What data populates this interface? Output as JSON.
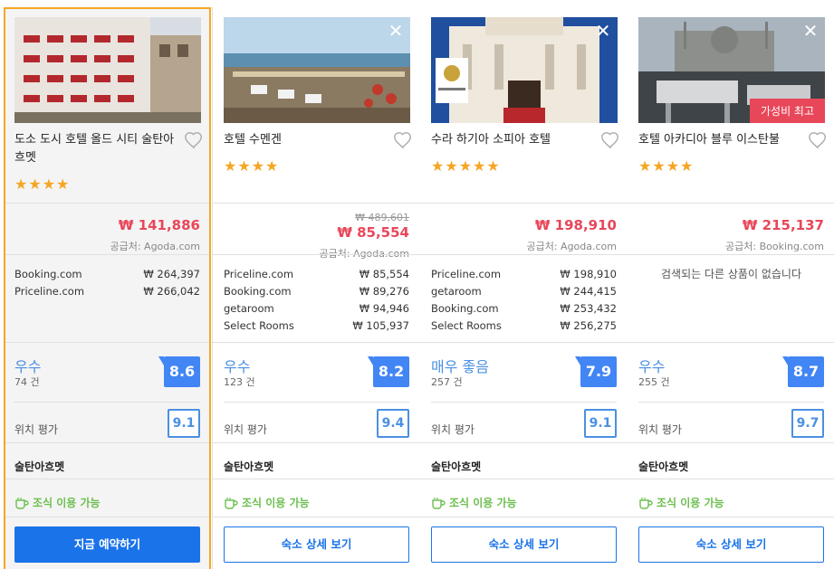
{
  "hotels": [
    {
      "name": "도소 도시 호텔 올드 시티 술탄아흐멧",
      "stars": "★★★★",
      "star_count": 4,
      "price_strike": "",
      "price": "₩ 141,886",
      "supplier": "공급처: Agoda.com",
      "offers": [
        {
          "site": "Booking.com",
          "amount": "₩  264,397"
        },
        {
          "site": "Priceline.com",
          "amount": "₩  266,042"
        }
      ],
      "no_offer_text": "",
      "rating_word": "우수",
      "review_count": "74 건",
      "score": "8.6",
      "location_label": "위치 평가",
      "location_score": "9.1",
      "area": "술탄아흐멧",
      "breakfast": "조식 이용 가능",
      "button": "지금 예약하기",
      "badge": "",
      "selected": true
    },
    {
      "name": "호텔 수멘겐",
      "stars": "★★★★",
      "star_count": 4,
      "price_strike": "₩ 489,601",
      "price": "₩ 85,554",
      "supplier": "공급처: Agoda.com",
      "offers": [
        {
          "site": "Priceline.com",
          "amount": "₩   85,554"
        },
        {
          "site": "Booking.com",
          "amount": "₩   89,276"
        },
        {
          "site": "getaroom",
          "amount": "₩   94,946"
        },
        {
          "site": "Select Rooms",
          "amount": "₩  105,937"
        }
      ],
      "no_offer_text": "",
      "rating_word": "우수",
      "review_count": "123 건",
      "score": "8.2",
      "location_label": "위치 평가",
      "location_score": "9.4",
      "area": "술탄아흐멧",
      "breakfast": "조식 이용 가능",
      "button": "숙소 상세 보기",
      "badge": "",
      "selected": false
    },
    {
      "name": "수라 하기아 소피아 호텔",
      "stars": "★★★★★",
      "star_count": 5,
      "price_strike": "",
      "price": "₩ 198,910",
      "supplier": "공급처: Agoda.com",
      "offers": [
        {
          "site": "Priceline.com",
          "amount": "₩  198,910"
        },
        {
          "site": "getaroom",
          "amount": "₩  244,415"
        },
        {
          "site": "Booking.com",
          "amount": "₩  253,432"
        },
        {
          "site": "Select Rooms",
          "amount": "₩  256,275"
        }
      ],
      "no_offer_text": "",
      "rating_word": "매우 좋음",
      "review_count": "257 건",
      "score": "7.9",
      "location_label": "위치 평가",
      "location_score": "9.1",
      "area": "술탄아흐멧",
      "breakfast": "조식 이용 가능",
      "button": "숙소 상세 보기",
      "badge": "",
      "selected": false
    },
    {
      "name": "호텔 아카디아 블루 이스탄불",
      "stars": "★★★★",
      "star_count": 4,
      "price_strike": "",
      "price": "₩ 215,137",
      "supplier": "공급처: Booking.com",
      "offers": [],
      "no_offer_text": "검색되는 다른 상품이 없습니다",
      "rating_word": "우수",
      "review_count": "255 건",
      "score": "8.7",
      "location_label": "위치 평가",
      "location_score": "9.7",
      "area": "술탄아흐멧",
      "breakfast": "조식 이용 가능",
      "button": "숙소 상세 보기",
      "badge": "가성비 최고",
      "selected": false
    }
  ],
  "colors": {
    "accent": "#1a73e8",
    "price": "#e8475a",
    "score": "#4285f4",
    "star": "#f5a623",
    "breakfast": "#6bbf4e",
    "selected_border": "#f5a623"
  }
}
